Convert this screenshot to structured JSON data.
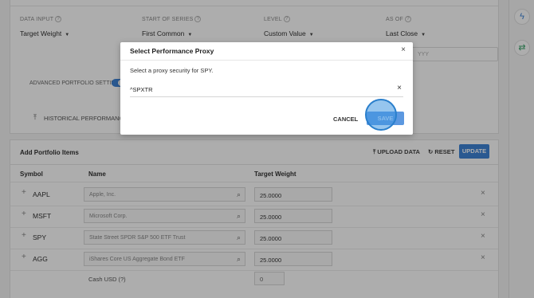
{
  "settings": {
    "data_input": {
      "label": "DATA INPUT",
      "value": "Target Weight"
    },
    "start_of_series": {
      "label": "START OF SERIES",
      "value": "First Common"
    },
    "level": {
      "label": "LEVEL",
      "value": "Custom Value"
    },
    "as_of": {
      "label": "AS OF",
      "value": "Last Close"
    },
    "date_placeholder": "YYY",
    "help_mark": "?",
    "advanced_label": "ADVANCED PORTFOLIO SETTINGS",
    "historical_label": "HISTORICAL PERFORMANCE (?)"
  },
  "portfolio": {
    "title": "Add Portfolio Items",
    "upload_label": "UPLOAD DATA",
    "reset_label": "RESET",
    "update_label": "UPDATE",
    "columns": {
      "symbol": "Symbol",
      "name": "Name",
      "weight": "Target Weight"
    },
    "rows": [
      {
        "symbol": "AAPL",
        "name": "Apple, Inc.",
        "weight": "25.0000"
      },
      {
        "symbol": "MSFT",
        "name": "Microsoft Corp.",
        "weight": "25.0000"
      },
      {
        "symbol": "SPY",
        "name": "State Street SPDR S&P 500 ETF Trust",
        "weight": "25.0000"
      },
      {
        "symbol": "AGG",
        "name": "iShares Core US Aggregate Bond ETF",
        "weight": "25.0000"
      }
    ],
    "cash": {
      "label": "Cash USD (?)",
      "value": "0"
    }
  },
  "modal": {
    "title": "Select Performance Proxy",
    "description": "Select a proxy security for SPY.",
    "input_value": "^SPXTR",
    "cancel_label": "CANCEL",
    "save_label": "SAVE"
  },
  "icons": {
    "close": "×",
    "search": "⌕",
    "plus": "+",
    "upload": "⤒",
    "reset": "↻",
    "lightning": "ϟ",
    "swap": "⇄"
  },
  "colors": {
    "accent": "#3f83d6",
    "save_button": "#5c98e0"
  }
}
